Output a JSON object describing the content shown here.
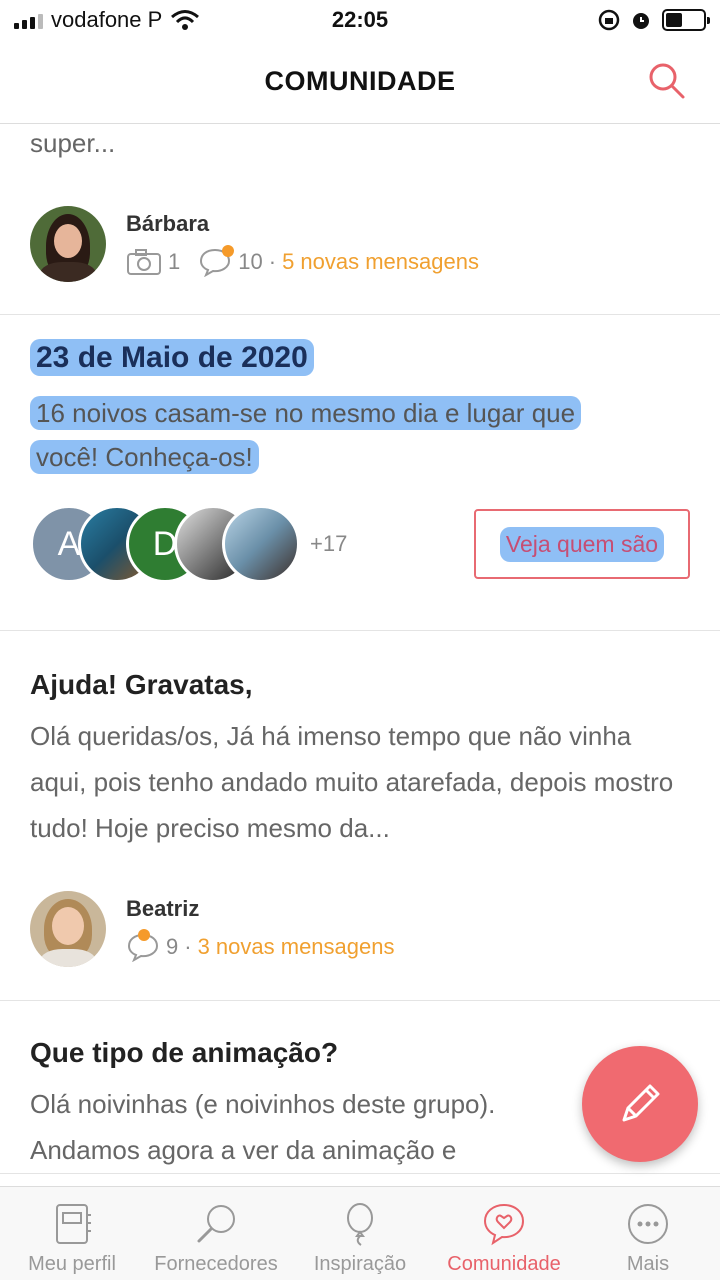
{
  "status_bar": {
    "carrier": "vodafone P",
    "time": "22:05"
  },
  "header": {
    "title": "COMUNIDADE"
  },
  "feed": {
    "truncated_text": "super...",
    "post_barbara": {
      "author": "Bárbara",
      "photos": "1",
      "comments": "10",
      "separator": "·",
      "new_messages": "5 novas mensagens"
    },
    "date_card": {
      "date": "23 de Maio de 2020",
      "description_line1": "16 noivos casam-se no mesmo dia e lugar que",
      "description_line2": "você! Conheça-os!",
      "avatar_letters": [
        "A",
        "D"
      ],
      "extra_count": "+17",
      "button_label": "Veja quem são"
    },
    "post_gravatas": {
      "title": "Ajuda! Gravatas,",
      "excerpt": "Olá queridas/os, Já há imenso tempo que não vinha aqui, pois tenho andado muito atarefada, depois mostro tudo! Hoje preciso mesmo da...",
      "author": "Beatriz",
      "comments": "9",
      "separator": "·",
      "new_messages": "3 novas mensagens"
    },
    "post_animacao": {
      "title": "Que tipo de animação?",
      "excerpt": "Olá noivinhas (e noivinhos deste grupo). Andamos agora a ver da animação e"
    }
  },
  "tabs": [
    {
      "label": "Meu perfil",
      "icon": "notebook-icon"
    },
    {
      "label": "Fornecedores",
      "icon": "magnifier-icon"
    },
    {
      "label": "Inspiração",
      "icon": "balloon-icon"
    },
    {
      "label": "Comunidade",
      "icon": "heart-bubble-icon",
      "active": true
    },
    {
      "label": "Mais",
      "icon": "more-icon"
    }
  ],
  "colors": {
    "accent": "#e8626a",
    "highlight": "#8fbff5",
    "new_messages": "#f0a030",
    "date_title": "#1a2f5a"
  }
}
